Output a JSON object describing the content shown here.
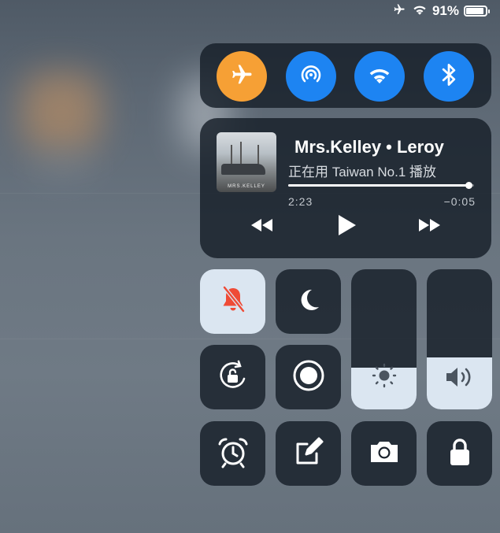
{
  "status_bar": {
    "airplane_icon": "airplane-icon",
    "wifi_icon": "wifi-icon",
    "battery_percent": "91%",
    "battery_level": 0.91
  },
  "connectivity": {
    "airplane": {
      "icon": "airplane-icon",
      "on": true,
      "color": "#f6a035"
    },
    "airdrop": {
      "icon": "airdrop-icon",
      "on": true,
      "color": "#1d84f2"
    },
    "wifi": {
      "icon": "wifi-icon",
      "on": true,
      "color": "#1d84f2"
    },
    "bluetooth": {
      "icon": "bluetooth-icon",
      "on": true,
      "color": "#1d84f2"
    }
  },
  "now_playing": {
    "title": "Mrs.Kelley • Leroy",
    "subtitle": "正在用 Taiwan No.1 播放",
    "album_caption": "MRS.KELLEY",
    "elapsed": "2:23",
    "remaining": "−0:05",
    "progress": 0.97,
    "controls": [
      "rewind-icon",
      "play-icon",
      "fast-forward-icon"
    ]
  },
  "tiles": {
    "silent": {
      "icon": "bell-slash-icon",
      "on": true,
      "color": "#ef4b36"
    },
    "do_not_disturb": {
      "icon": "moon-icon",
      "on": false
    },
    "rotation_lock": {
      "icon": "rotation-lock-icon",
      "on": false
    },
    "screen_record": {
      "icon": "record-icon",
      "on": false
    },
    "alarm": {
      "icon": "alarm-clock-icon"
    },
    "notes": {
      "icon": "notes-icon"
    },
    "camera": {
      "icon": "camera-icon"
    },
    "lock": {
      "icon": "lock-icon"
    }
  },
  "sliders": {
    "brightness": {
      "icon": "sun-icon",
      "level": 0.3
    },
    "volume": {
      "icon": "speaker-icon",
      "level": 0.37
    }
  }
}
